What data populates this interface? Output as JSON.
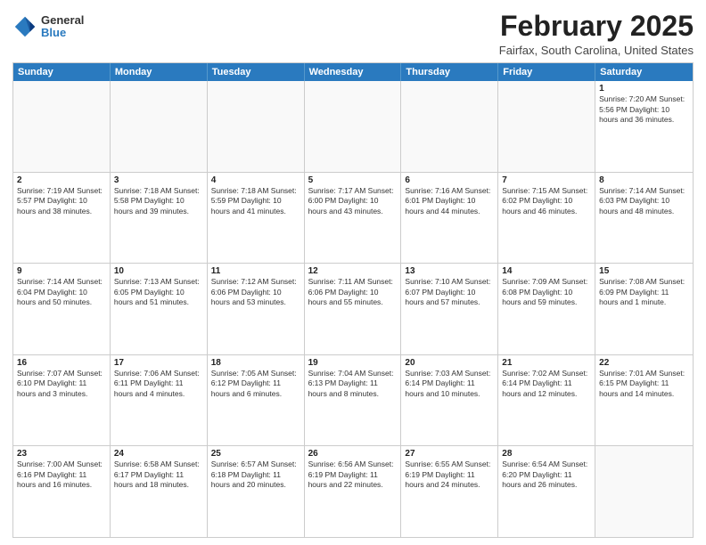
{
  "header": {
    "logo": {
      "general": "General",
      "blue": "Blue"
    },
    "title": "February 2025",
    "location": "Fairfax, South Carolina, United States"
  },
  "calendar": {
    "days_of_week": [
      "Sunday",
      "Monday",
      "Tuesday",
      "Wednesday",
      "Thursday",
      "Friday",
      "Saturday"
    ],
    "weeks": [
      [
        {
          "day": "",
          "info": ""
        },
        {
          "day": "",
          "info": ""
        },
        {
          "day": "",
          "info": ""
        },
        {
          "day": "",
          "info": ""
        },
        {
          "day": "",
          "info": ""
        },
        {
          "day": "",
          "info": ""
        },
        {
          "day": "1",
          "info": "Sunrise: 7:20 AM\nSunset: 5:56 PM\nDaylight: 10 hours\nand 36 minutes."
        }
      ],
      [
        {
          "day": "2",
          "info": "Sunrise: 7:19 AM\nSunset: 5:57 PM\nDaylight: 10 hours\nand 38 minutes."
        },
        {
          "day": "3",
          "info": "Sunrise: 7:18 AM\nSunset: 5:58 PM\nDaylight: 10 hours\nand 39 minutes."
        },
        {
          "day": "4",
          "info": "Sunrise: 7:18 AM\nSunset: 5:59 PM\nDaylight: 10 hours\nand 41 minutes."
        },
        {
          "day": "5",
          "info": "Sunrise: 7:17 AM\nSunset: 6:00 PM\nDaylight: 10 hours\nand 43 minutes."
        },
        {
          "day": "6",
          "info": "Sunrise: 7:16 AM\nSunset: 6:01 PM\nDaylight: 10 hours\nand 44 minutes."
        },
        {
          "day": "7",
          "info": "Sunrise: 7:15 AM\nSunset: 6:02 PM\nDaylight: 10 hours\nand 46 minutes."
        },
        {
          "day": "8",
          "info": "Sunrise: 7:14 AM\nSunset: 6:03 PM\nDaylight: 10 hours\nand 48 minutes."
        }
      ],
      [
        {
          "day": "9",
          "info": "Sunrise: 7:14 AM\nSunset: 6:04 PM\nDaylight: 10 hours\nand 50 minutes."
        },
        {
          "day": "10",
          "info": "Sunrise: 7:13 AM\nSunset: 6:05 PM\nDaylight: 10 hours\nand 51 minutes."
        },
        {
          "day": "11",
          "info": "Sunrise: 7:12 AM\nSunset: 6:06 PM\nDaylight: 10 hours\nand 53 minutes."
        },
        {
          "day": "12",
          "info": "Sunrise: 7:11 AM\nSunset: 6:06 PM\nDaylight: 10 hours\nand 55 minutes."
        },
        {
          "day": "13",
          "info": "Sunrise: 7:10 AM\nSunset: 6:07 PM\nDaylight: 10 hours\nand 57 minutes."
        },
        {
          "day": "14",
          "info": "Sunrise: 7:09 AM\nSunset: 6:08 PM\nDaylight: 10 hours\nand 59 minutes."
        },
        {
          "day": "15",
          "info": "Sunrise: 7:08 AM\nSunset: 6:09 PM\nDaylight: 11 hours\nand 1 minute."
        }
      ],
      [
        {
          "day": "16",
          "info": "Sunrise: 7:07 AM\nSunset: 6:10 PM\nDaylight: 11 hours\nand 3 minutes."
        },
        {
          "day": "17",
          "info": "Sunrise: 7:06 AM\nSunset: 6:11 PM\nDaylight: 11 hours\nand 4 minutes."
        },
        {
          "day": "18",
          "info": "Sunrise: 7:05 AM\nSunset: 6:12 PM\nDaylight: 11 hours\nand 6 minutes."
        },
        {
          "day": "19",
          "info": "Sunrise: 7:04 AM\nSunset: 6:13 PM\nDaylight: 11 hours\nand 8 minutes."
        },
        {
          "day": "20",
          "info": "Sunrise: 7:03 AM\nSunset: 6:14 PM\nDaylight: 11 hours\nand 10 minutes."
        },
        {
          "day": "21",
          "info": "Sunrise: 7:02 AM\nSunset: 6:14 PM\nDaylight: 11 hours\nand 12 minutes."
        },
        {
          "day": "22",
          "info": "Sunrise: 7:01 AM\nSunset: 6:15 PM\nDaylight: 11 hours\nand 14 minutes."
        }
      ],
      [
        {
          "day": "23",
          "info": "Sunrise: 7:00 AM\nSunset: 6:16 PM\nDaylight: 11 hours\nand 16 minutes."
        },
        {
          "day": "24",
          "info": "Sunrise: 6:58 AM\nSunset: 6:17 PM\nDaylight: 11 hours\nand 18 minutes."
        },
        {
          "day": "25",
          "info": "Sunrise: 6:57 AM\nSunset: 6:18 PM\nDaylight: 11 hours\nand 20 minutes."
        },
        {
          "day": "26",
          "info": "Sunrise: 6:56 AM\nSunset: 6:19 PM\nDaylight: 11 hours\nand 22 minutes."
        },
        {
          "day": "27",
          "info": "Sunrise: 6:55 AM\nSunset: 6:19 PM\nDaylight: 11 hours\nand 24 minutes."
        },
        {
          "day": "28",
          "info": "Sunrise: 6:54 AM\nSunset: 6:20 PM\nDaylight: 11 hours\nand 26 minutes."
        },
        {
          "day": "",
          "info": ""
        }
      ]
    ]
  }
}
